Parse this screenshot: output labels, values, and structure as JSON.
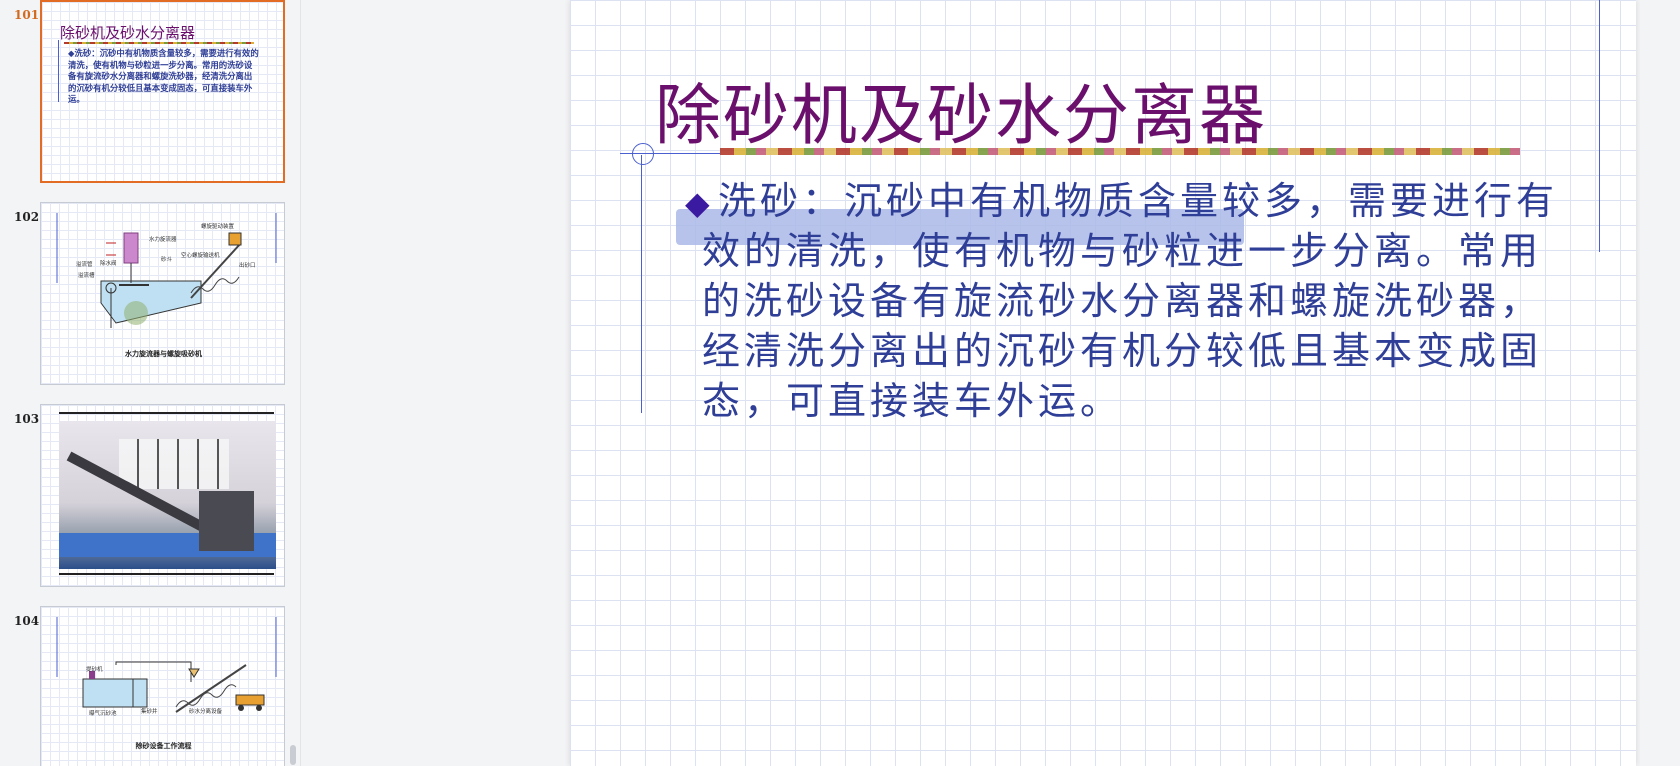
{
  "thumbnails": [
    {
      "number": "101",
      "title": "除砂机及砂水分离器",
      "body": "◆洗砂：沉砂中有机物质含量较多，需要进行有效的清洗，使有机物与砂粒进一步分离。常用的洗砂设备有旋流砂水分离器和螺旋洗砂器，经清洗分离出的沉砂有机分较低且基本变成固态，可直接装车外运。"
    },
    {
      "number": "102",
      "caption": "水力旋流器与螺旋吸砂机",
      "labels": [
        "水力旋流器",
        "螺旋驱动装置",
        "溢流管",
        "除水阀",
        "砂斗",
        "溢流槽",
        "空心螺旋输送机",
        "出砂口"
      ]
    },
    {
      "number": "103"
    },
    {
      "number": "104",
      "caption": "除砂设备工作流程",
      "labels": [
        "提砂机",
        "曝气沉砂池",
        "集砂井",
        "砂水分离设备"
      ]
    }
  ],
  "slide": {
    "title": "除砂机及砂水分离器",
    "bullet_icon": "◆",
    "bullet_text": "洗砂：沉砂中有机物质含量较多，需要进行有效的清洗，使有机物与砂粒进一步分离。常用的洗砂设备有旋流砂水分离器和螺旋洗砂器，经清洗分离出的沉砂有机分较低且基本变成固态，可直接装车外运。"
  },
  "colors": {
    "title": "#6a0f6b",
    "body_text": "#2f3e96",
    "selected_border": "#e36c25",
    "accent_line": "#4a5fd0"
  }
}
